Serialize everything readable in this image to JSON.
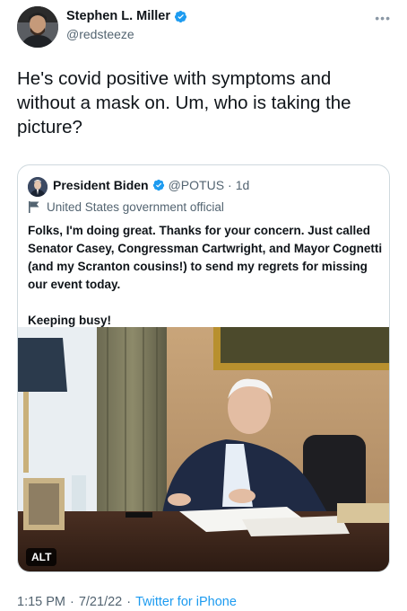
{
  "author": {
    "display_name": "Stephen L. Miller",
    "handle": "@redsteeze"
  },
  "more_icon": "more-horizontal-icon",
  "tweet": {
    "text": "He's covid positive with symptoms and without a mask on. Um, who is taking the picture?"
  },
  "quoted": {
    "display_name": "President Biden",
    "handle": "@POTUS",
    "separator": "·",
    "time": "1d",
    "label": "United States government official",
    "body_1": "Folks, I'm doing great. Thanks for your concern. Just called Senator Casey, Congressman Cartwright, and Mayor Cognetti (and my Scranton cousins!) to send my regrets for missing our event today.",
    "body_2": "Keeping busy!",
    "alt_badge": "ALT"
  },
  "footer": {
    "time": "1:15 PM",
    "sep1": "·",
    "date": "7/21/22",
    "sep2": "·",
    "source": "Twitter for iPhone"
  },
  "colors": {
    "accent": "#1d9bf0",
    "secondary_text": "#536471"
  }
}
